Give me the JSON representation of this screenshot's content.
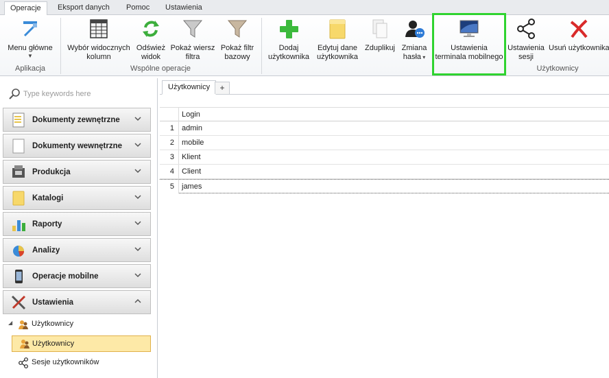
{
  "ribbon_tabs": [
    "Operacje",
    "Eksport danych",
    "Pomoc",
    "Ustawienia"
  ],
  "ribbon": {
    "buttons": {
      "menu": "Menu główne",
      "columns": "Wybór widocznych\nkolumn",
      "refresh": "Odśwież\nwidok",
      "filter_row": "Pokaż wiersz\nfiltra",
      "filter_base": "Pokaż filtr\nbazowy",
      "add_user": "Dodaj\nużytkownika",
      "edit_user": "Edytuj dane\nużytkownika",
      "duplicate": "Zduplikuj",
      "change_pass": "Zmiana\nhasła",
      "mobile_terminal": "Ustawienia\nterminala mobilnego",
      "session_settings": "Ustawienia\nsesji",
      "delete_user": "Usuń użytkownika"
    },
    "groups": {
      "app": "Aplikacja",
      "common": "Wspólne operacje",
      "users": "Użytkownicy"
    }
  },
  "search": {
    "placeholder": "Type keywords here"
  },
  "nav_groups": [
    "Dokumenty zewnętrzne",
    "Dokumenty wewnętrzne",
    "Produkcja",
    "Katalogi",
    "Raporty",
    "Analizy",
    "Operacje mobilne",
    "Ustawienia"
  ],
  "tree": {
    "parent": "Użytkownicy",
    "selected": "Użytkownicy",
    "sessions": "Sesje użytkowników"
  },
  "doc_tab": {
    "label": "Użytkownicy",
    "add": "+"
  },
  "grid": {
    "column": "Login",
    "rows": [
      {
        "num": "1",
        "login": "admin"
      },
      {
        "num": "2",
        "login": "mobile"
      },
      {
        "num": "3",
        "login": "Klient"
      },
      {
        "num": "4",
        "login": "Client"
      },
      {
        "num": "5",
        "login": "james"
      }
    ]
  },
  "colors": {
    "highlight": "#2fd32f",
    "selection": "#fde9a7",
    "accent_blue": "#2e7bd6"
  }
}
